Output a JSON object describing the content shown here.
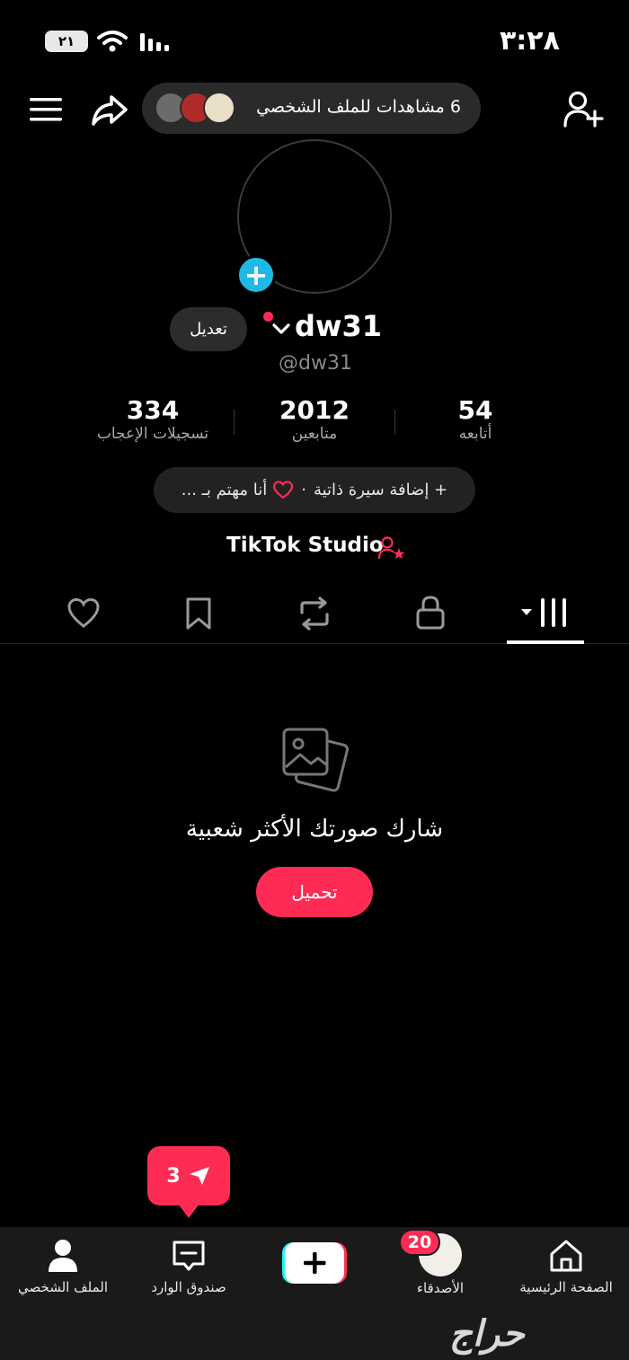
{
  "status_bar": {
    "time": "٣:٢٨",
    "battery": "٢١"
  },
  "top_bar": {
    "profile_views": "6 مشاهدات للملف الشخصي"
  },
  "profile": {
    "edit_label": "تعديل",
    "username": "dw31",
    "handle": "@dw31",
    "stats": [
      {
        "value": "334",
        "label": "تسجيلات الإعجاب"
      },
      {
        "value": "2012",
        "label": "متابعين"
      },
      {
        "value": "54",
        "label": "أتابعه"
      }
    ],
    "bio_add": "+ إضافة سيرة ذاتية",
    "bio_sep": "·",
    "interest": "أنا مهتم بـ ...",
    "studio": "TikTok Studio"
  },
  "empty_state": {
    "title": "شارك صورتك الأكثر شعبية",
    "upload_label": "تحميل"
  },
  "toast": {
    "count": "3"
  },
  "bottom_nav": {
    "home": "الصفحة الرئيسية",
    "friends": "الأصدقاء",
    "friends_badge": "20",
    "inbox": "صندوق الوارد",
    "profile": "الملف الشخصي"
  },
  "watermark": "حراج",
  "colors": {
    "accent": "#fe2c55",
    "blue": "#20b9e6",
    "background": "#000000"
  }
}
